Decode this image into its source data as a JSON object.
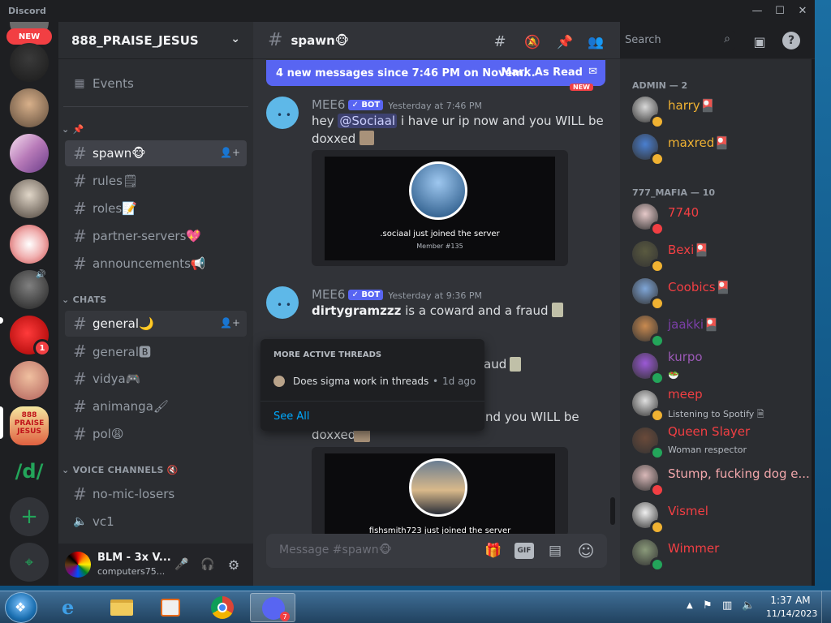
{
  "window": {
    "title": "Discord",
    "controls": [
      "—",
      "☐",
      "✕"
    ]
  },
  "rail": {
    "new_label": "NEW",
    "badge_count": "1",
    "add_icon": "plus-icon",
    "explore_icon": "compass-icon"
  },
  "guild": {
    "name": "888_PRAISE_JESUS"
  },
  "sidebar": {
    "events_label": "Events",
    "channels": [
      {
        "label": "spawn🐵",
        "active": true
      },
      {
        "label": "rules🗒"
      },
      {
        "label": "roles📝"
      },
      {
        "label": "partner-servers💖"
      },
      {
        "label": "announcements📢"
      }
    ],
    "chats_category": "CHATS",
    "chats": [
      {
        "label": "general🌙",
        "hover": true
      },
      {
        "label": "general🅱"
      },
      {
        "label": "vidya🎮"
      },
      {
        "label": "animanga🖌"
      },
      {
        "label": "pol😩"
      }
    ],
    "voice_category": "VOICE CHANNELS 🔇",
    "voice": [
      {
        "label": "no-mic-losers"
      },
      {
        "label": "vc1"
      }
    ]
  },
  "user_panel": {
    "name": "BLM - 3x V...",
    "status": "computers75..."
  },
  "header": {
    "channel": "spawn🐵",
    "search_placeholder": "Search"
  },
  "newbar": {
    "text": "4 new messages since 7:46 PM on Novem...",
    "action": "Mark As Read"
  },
  "new_tag": "NEW",
  "messages": [
    {
      "author": "MEE6",
      "bot": "✓ BOT",
      "time": "Yesterday at 7:46 PM",
      "pre": "hey ",
      "mention": "@Sociaal",
      "post": " i have ur ip now and you WILL be doxxed",
      "card_text": ".sociaal just joined the server",
      "card_sub": "Member #135"
    },
    {
      "author": "MEE6",
      "bot": "✓ BOT",
      "time": "Yesterday at 9:36 PM",
      "bold": "dirtygramzzz",
      "post": " is a coward and a fraud"
    },
    {
      "partial1": "aud",
      "partial2": "nd you WILL be",
      "partial3": "doxxed",
      "card_text": "fishsmith723 just joined the server"
    }
  ],
  "threads": {
    "title": "MORE ACTIVE THREADS",
    "item": "Does sigma work in threads",
    "age": "1d ago",
    "see_all": "See All"
  },
  "composer": {
    "placeholder": "Message #spawn🐵"
  },
  "members": {
    "admin_header": "ADMIN — 2",
    "admins": [
      {
        "name": "harry🎴",
        "color": "#f0b232",
        "avatar": "#d8d8d8",
        "status": "#f0b232"
      },
      {
        "name": "maxred🎴",
        "color": "#f0b232",
        "avatar": "#4a7fd0",
        "status": "#f0b232"
      }
    ],
    "mafia_header": "777_MAFIA — 10",
    "mafia": [
      {
        "name": "7740",
        "color": "#f23f43",
        "avatar": "#e6c9c9",
        "status": "#f23f43"
      },
      {
        "name": "Bexi🎴",
        "color": "#f23f43",
        "avatar": "#5a5a40",
        "status": "#f0b232"
      },
      {
        "name": "Coobics🎴",
        "color": "#f23f43",
        "avatar": "#7fa6d8",
        "status": "#f0b232"
      },
      {
        "name": "jaakki🎴",
        "color": "#7b3fa8",
        "avatar": "#c98a50",
        "status": "#23a55a"
      },
      {
        "name": "kurpo",
        "color": "#9b59b6",
        "avatar": "#9b59d6",
        "status": "#23a55a",
        "sub": "🥗"
      },
      {
        "name": "meep",
        "color": "#f23f43",
        "avatar": "#e0e0e0",
        "status": "#f0b232",
        "sub": "Listening to Spotify 🗎"
      },
      {
        "name": "Queen Slayer",
        "color": "#f23f43",
        "avatar": "#6a4a3a",
        "status": "#23a55a",
        "sub": "Woman respector"
      },
      {
        "name": "Stump, fucking dog e...",
        "color": "#f2a7ab",
        "avatar": "#d9b8b8",
        "status": "#f23f43"
      },
      {
        "name": "Vismel",
        "color": "#f23f43",
        "avatar": "#f0f0f0",
        "status": "#f0b232"
      },
      {
        "name": "Wimmer",
        "color": "#f23f43",
        "avatar": "#8a9a7a",
        "status": "#23a55a"
      }
    ]
  },
  "taskbar": {
    "time": "1:37 AM",
    "date": "11/14/2023",
    "discord_badge": "7"
  }
}
